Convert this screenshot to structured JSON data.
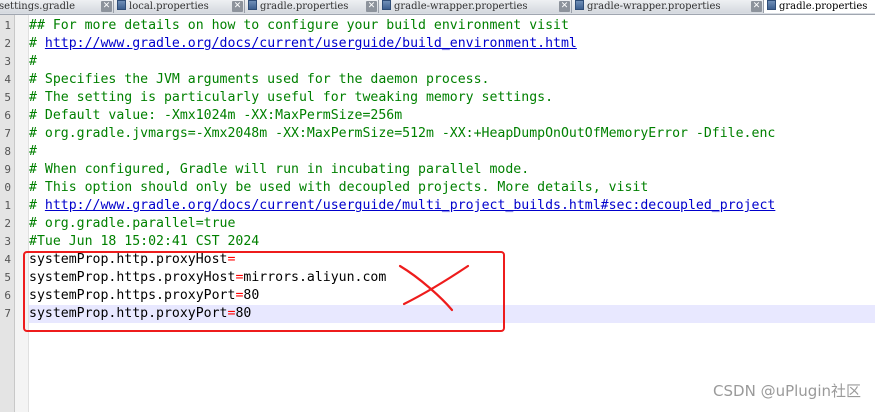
{
  "tabs": [
    {
      "label": "settings.gradle",
      "active": false
    },
    {
      "label": "local.properties",
      "active": false
    },
    {
      "label": "gradle.properties",
      "active": false
    },
    {
      "label": "gradle-wrapper.properties",
      "active": false
    },
    {
      "label": "gradle-wrapper.properties",
      "active": false
    },
    {
      "label": "gradle.properties",
      "active": true
    }
  ],
  "line_numbers": [
    "1",
    "2",
    "3",
    "4",
    "5",
    "6",
    "7",
    "8",
    "9",
    "0",
    "1",
    "2",
    "3",
    "4",
    "5",
    "6",
    "7"
  ],
  "lines": [
    "## For more details on how to configure your build environment visit",
    "# http://www.gradle.org/docs/current/userguide/build_environment.html",
    "#",
    "# Specifies the JVM arguments used for the daemon process.",
    "# The setting is particularly useful for tweaking memory settings.",
    "# Default value: -Xmx1024m -XX:MaxPermSize=256m",
    "# org.gradle.jvmargs=-Xmx2048m -XX:MaxPermSize=512m -XX:+HeapDumpOnOutOfMemoryError -Dfile.enc",
    "#",
    "# When configured, Gradle will run in incubating parallel mode.",
    "# This option should only be used with decoupled projects. More details, visit",
    "# http://www.gradle.org/docs/current/userguide/multi_project_builds.html#sec:decoupled_project",
    "# org.gradle.parallel=true",
    "#Tue Jun 18 15:02:41 CST 2024",
    "systemProp.http.proxyHost=",
    "systemProp.https.proxyHost=mirrors.aliyun.com",
    "systemProp.https.proxyPort=80",
    "systemProp.http.proxyPort=80"
  ],
  "props": [
    {
      "key": "systemProp.http.proxyHost",
      "eq": "=",
      "value": ""
    },
    {
      "key": "systemProp.https.proxyHost",
      "eq": "=",
      "value": "mirrors.aliyun.com"
    },
    {
      "key": "systemProp.https.proxyPort",
      "eq": "=",
      "value": "80"
    },
    {
      "key": "systemProp.http.proxyPort",
      "eq": "=",
      "value": "80"
    }
  ],
  "link_prefix": "# ",
  "links": [
    "http://www.gradle.org/docs/current/userguide/build_environment.html",
    "http://www.gradle.org/docs/current/userguide/multi_project_builds.html#sec:decoupled_project"
  ],
  "watermark": "CSDN @uPlugin社区",
  "colors": {
    "comment": "#008000",
    "link": "#0000cc",
    "equals": "#ff0000",
    "current_line": "#e8e8ff",
    "annotation_red": "#ee1c1c"
  },
  "current_line_number": "7",
  "annotation": {
    "shape": "red-box-and-cross",
    "meaning": "highlight proxy settings"
  }
}
